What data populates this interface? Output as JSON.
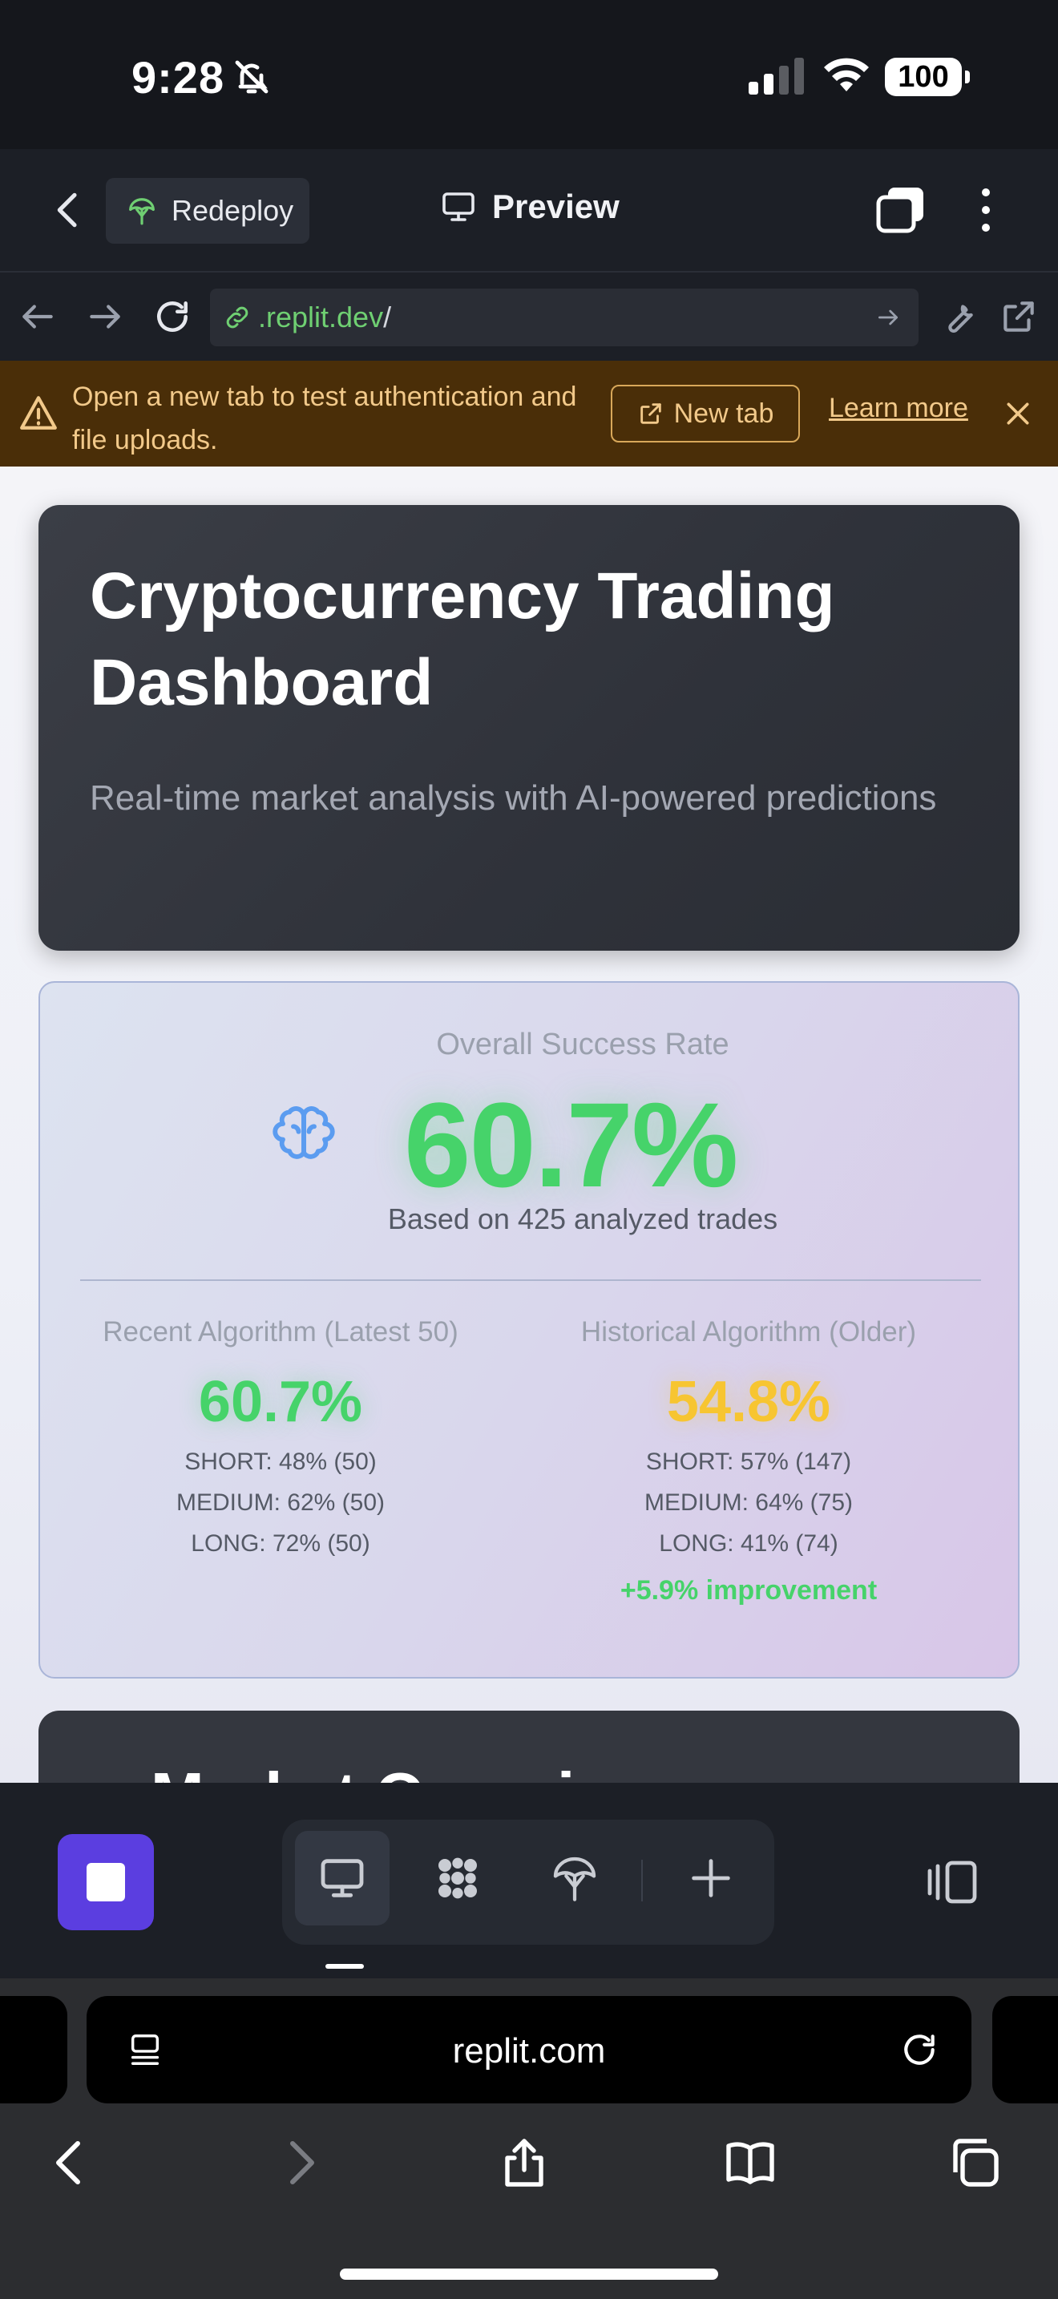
{
  "status_bar": {
    "time": "9:28",
    "battery": "100"
  },
  "topbar": {
    "redeploy_label": "Redeploy",
    "preview_label": "Preview"
  },
  "urlbar": {
    "host": ".replit.dev",
    "path": "/"
  },
  "banner": {
    "message": "Open a new tab to test authentication and file uploads.",
    "new_tab_label": "New tab",
    "learn_more_label": "Learn more"
  },
  "hero": {
    "title": "Cryptocurrency Trading Dashboard",
    "subtitle": "Real-time market analysis with AI-powered predictions"
  },
  "stats": {
    "heading": "Overall Success Rate",
    "overall_rate": "60.7%",
    "based_on": "Based on 425 analyzed trades",
    "recent": {
      "title": "Recent Algorithm (Latest 50)",
      "rate": "60.7%",
      "lines": [
        "SHORT: 48% (50)",
        "MEDIUM: 62% (50)",
        "LONG: 72% (50)"
      ]
    },
    "historical": {
      "title": "Historical Algorithm (Older)",
      "rate": "54.8%",
      "lines": [
        "SHORT: 57% (147)",
        "MEDIUM: 64% (75)",
        "LONG: 41% (74)"
      ],
      "improvement": "+5.9% improvement"
    }
  },
  "next_card": {
    "title_partial": "Market Overview"
  },
  "safari": {
    "host": "replit.com"
  },
  "colors": {
    "accent_green": "#46d36a",
    "accent_yellow": "#f7c531",
    "stop_button": "#5b3ee0",
    "banner_bg": "#4a2e08"
  },
  "icons": {
    "dock": [
      "monitor-icon",
      "apps-icon",
      "deploy-icon",
      "plus-icon"
    ]
  }
}
